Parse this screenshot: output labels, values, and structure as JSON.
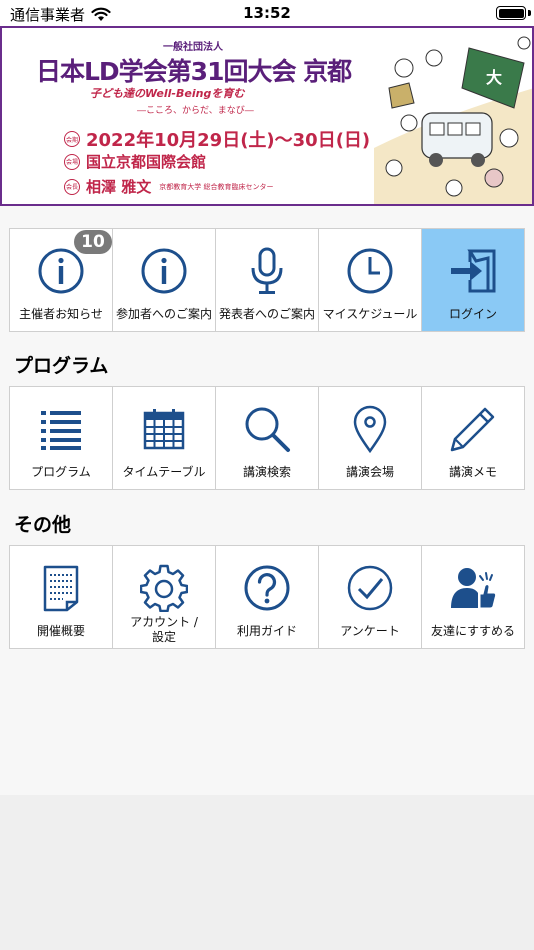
{
  "status": {
    "carrier": "通信事業者",
    "time": "13:52"
  },
  "banner": {
    "org": "一般社団法人",
    "title": "日本LD学会第31回大会 京都",
    "theme": "子ども達のWell-Beingを育む",
    "subtheme": "―こころ、からだ、まなび―",
    "date_tag": "会期",
    "date": "2022年10月29日(土)～30日(日)",
    "venue_tag": "会場",
    "venue": "国立京都国際会館",
    "chair_tag": "会長",
    "chair": "相澤 雅文",
    "chair_affil": "京都教育大学 総合教育臨床センター"
  },
  "top_menu": [
    {
      "label": "主催者お知らせ",
      "icon": "info-icon",
      "badge": "10"
    },
    {
      "label": "参加者へのご案内",
      "icon": "info-icon"
    },
    {
      "label": "発表者へのご案内",
      "icon": "microphone-icon"
    },
    {
      "label": "マイスケジュール",
      "icon": "clock-icon"
    },
    {
      "label": "ログイン",
      "icon": "login-icon",
      "active": true
    }
  ],
  "program_section": {
    "title": "プログラム",
    "items": [
      {
        "label": "プログラム",
        "icon": "list-icon"
      },
      {
        "label": "タイムテーブル",
        "icon": "calendar-icon"
      },
      {
        "label": "講演検索",
        "icon": "search-icon"
      },
      {
        "label": "講演会場",
        "icon": "map-pin-icon"
      },
      {
        "label": "講演メモ",
        "icon": "pencil-icon"
      }
    ]
  },
  "other_section": {
    "title": "その他",
    "items": [
      {
        "label": "開催概要",
        "icon": "document-icon"
      },
      {
        "label_line1": "アカウント /",
        "label_line2": "設定",
        "icon": "gear-icon"
      },
      {
        "label": "利用ガイド",
        "icon": "question-icon"
      },
      {
        "label": "アンケート",
        "icon": "checkmark-icon"
      },
      {
        "label": "友達にすすめる",
        "icon": "recommend-icon"
      }
    ]
  },
  "colors": {
    "icon_blue": "#1d4f8c",
    "active_bg": "#8ac9f5",
    "banner_purple": "#5a1f7a",
    "banner_red": "#c0264a"
  }
}
